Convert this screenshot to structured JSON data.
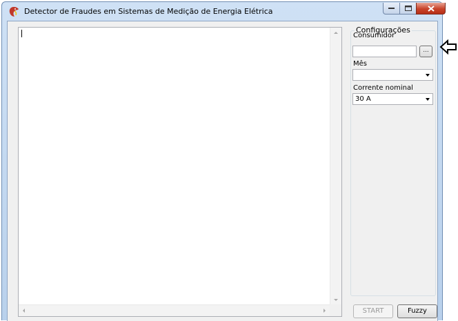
{
  "window": {
    "title": "Detector de Fraudes em Sistemas de Medição de Energia Elétrica",
    "icon": "dragon-app-icon"
  },
  "output": {
    "text": ""
  },
  "config": {
    "group_title": "Configurações",
    "consumer_label": "Consumidor",
    "consumer_value": "",
    "browse_label": "...",
    "month_label": "Mês",
    "month_value": "",
    "current_label": "Corrente nominal",
    "current_value": "30 A"
  },
  "actions": {
    "start_label": "START",
    "start_enabled": false,
    "fuzzy_label": "Fuzzy"
  },
  "annotation": {
    "icon": "pointer-arrow-icon"
  },
  "colors": {
    "title_bar": "#c4d9f1",
    "close_button": "#c8432b",
    "client_bg": "#f0f0f0"
  }
}
